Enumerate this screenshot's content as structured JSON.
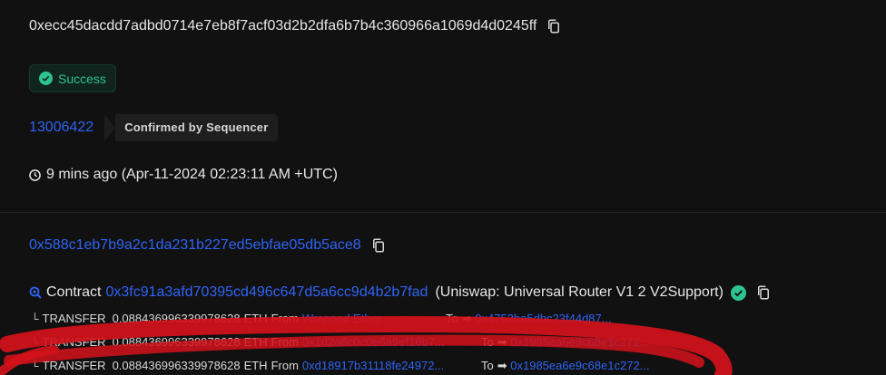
{
  "tx_hash": "0xecc45dacdd7adbd0714e7eb8f7acf03d2b2dfa6b7b4c360966a1069d4d0245ff",
  "status": {
    "label": "Success",
    "color": "#2ec48f"
  },
  "block": {
    "number": "13006422",
    "tag": "Confirmed by Sequencer"
  },
  "timestamp": {
    "label": "9 mins ago (Apr-11-2024 02:23:11 AM +UTC)"
  },
  "from": {
    "address": "0x588c1eb7b9a2c1da231b227ed5ebfae05db5ace8"
  },
  "interacted_with": {
    "prefix": "Contract",
    "address": "0x3fc91a3afd70395cd496c647d5a6cc9d4b2b7fad",
    "name": "(Uniswap: Universal Router V1 2 V2Support)"
  },
  "transfers": [
    {
      "elbow": "└",
      "label": "TRANSFER",
      "amount": "0.088436996339978628",
      "token": "ETH",
      "from_label": "From",
      "from": "Wrapped Ether",
      "to_label": "To",
      "to": "0x4752ba5dbc23f44d87..."
    },
    {
      "elbow": "└",
      "label": "TRANSFER",
      "amount": "0.088436996339978628",
      "token": "ETH",
      "from_label": "From",
      "from": "0x1d2a8c0c0e6a9ef16b7...",
      "to_label": "To",
      "to": "0x1985ea6e9c68e1c272..."
    },
    {
      "elbow": "└",
      "label": "TRANSFER",
      "amount": "0.088436996339978628",
      "token": "ETH",
      "from_label": "From",
      "from": "0xd18917b31118fe24972...",
      "to_label": "To",
      "to": "0x1985ea6e9c68e1c272..."
    }
  ],
  "icons": {
    "copy": "copy-icon",
    "success": "check-circle-icon",
    "clock": "clock-icon",
    "search": "search-icon",
    "verified": "verified-check-icon",
    "arrow": "arrow-right-icon"
  },
  "colors": {
    "link": "#2f64f5",
    "accent_green": "#2ec48f",
    "redaction": "#d5121b"
  }
}
